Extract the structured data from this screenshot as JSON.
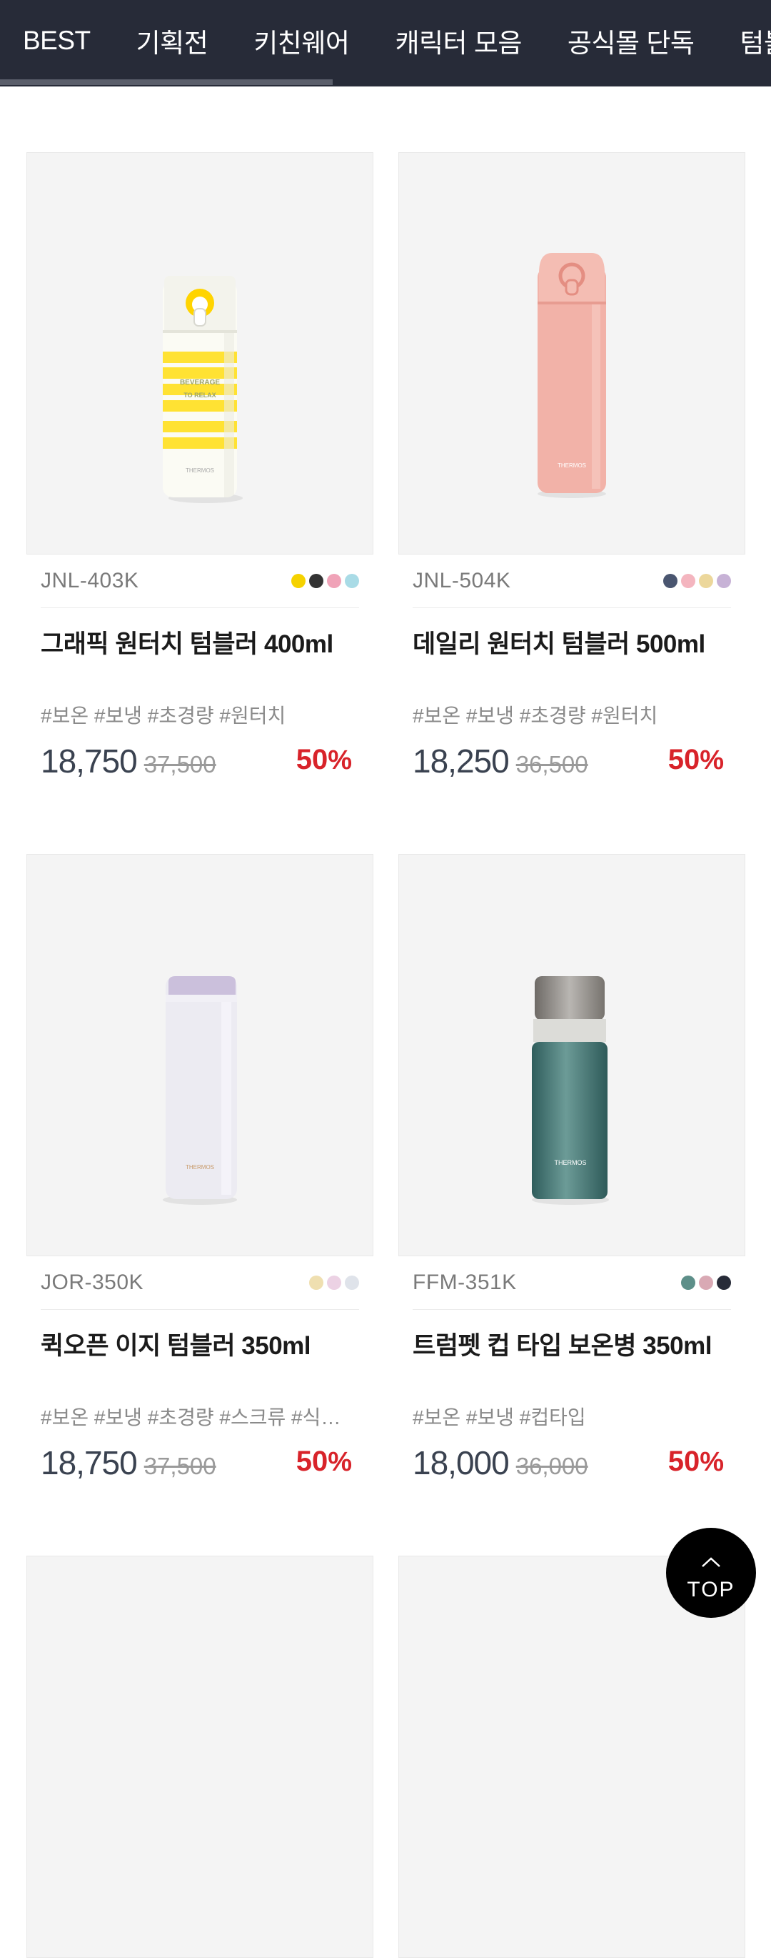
{
  "nav": {
    "tabs": [
      "BEST",
      "기획전",
      "키친웨어",
      "캐릭터 모음",
      "공식몰 단독",
      "텀블러"
    ]
  },
  "products": [
    {
      "model": "JNL-403K",
      "name": "그래픽 원터치 텀블러 400ml",
      "tags": "#보온 #보냉 #초경량 #원터치",
      "price": "18,750",
      "original_price": "37,500",
      "discount": "50",
      "discount_unit": "%",
      "swatches": [
        "#f5d200",
        "#333333",
        "#f0a3b8",
        "#a9dbe6"
      ],
      "image": {
        "label": "THERMOS",
        "print_lines": [
          "BEVERAGE",
          "TO RELAX"
        ]
      }
    },
    {
      "model": "JNL-504K",
      "name": "데일리 원터치 텀블러 500ml",
      "tags": "#보온 #보냉 #초경량 #원터치",
      "price": "18,250",
      "original_price": "36,500",
      "discount": "50",
      "discount_unit": "%",
      "swatches": [
        "#4a5670",
        "#f4b5bf",
        "#ecd79b",
        "#c7b2d6"
      ],
      "image": {
        "label": "THERMOS"
      }
    },
    {
      "model": "JOR-350K",
      "name": "퀵오픈 이지 텀블러 350ml",
      "tags": "#보온 #보냉 #초경량 #스크류 #식기세척기",
      "price": "18,750",
      "original_price": "37,500",
      "discount": "50",
      "discount_unit": "%",
      "swatches": [
        "#efdfb0",
        "#ecd2e4",
        "#dfe3ea"
      ],
      "image": {
        "label": "THERMOS"
      }
    },
    {
      "model": "FFM-351K",
      "name": "트럼펫 컵 타입 보온병 350ml",
      "tags": "#보온 #보냉 #컵타입",
      "price": "18,000",
      "original_price": "36,000",
      "discount": "50",
      "discount_unit": "%",
      "swatches": [
        "#5d8f89",
        "#d9a9b4",
        "#272b38"
      ],
      "image": {
        "label": "THERMOS"
      }
    }
  ],
  "top_button": {
    "label": "TOP"
  },
  "colors": {
    "nav_bg": "#272b38",
    "price": "#3a4250",
    "discount": "#d8232a",
    "card_bg": "#f4f4f4"
  }
}
